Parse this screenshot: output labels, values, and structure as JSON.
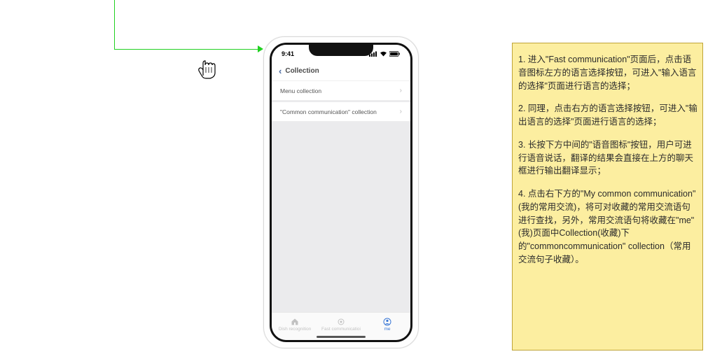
{
  "connector": {
    "arrow": true
  },
  "phone": {
    "status": {
      "time": "9:41",
      "signal": "▮▮▮▮",
      "wifi": "�礪",
      "battery": "▬"
    },
    "nav": {
      "title": "Collection"
    },
    "list": [
      {
        "label": "Menu collection"
      },
      {
        "label": "\"Common communication\" collection"
      }
    ],
    "tabs": [
      {
        "label": "Dish recognition",
        "icon": "home"
      },
      {
        "label": "Fast communicatioi",
        "icon": "target"
      },
      {
        "label": "me",
        "icon": "user",
        "active": true
      }
    ]
  },
  "note": {
    "paragraphs": [
      "1. 进入\"Fast communication\"页面后，点击语音图标左方的语言选择按钮，可进入\"输入语言的选择\"页面进行语言的选择；",
      "2. 同理，点击右方的语言选择按钮，可进入\"输出语言的选择\"页面进行语言的选择；",
      "3. 长按下方中间的\"语音图标\"按钮，用户可进行语音说话，翻译的结果会直接在上方的聊天框进行输出翻译显示；",
      "4. 点击右下方的\"My common communication\"(我的常用交流)，将可对收藏的常用交流语句进行查找，另外，常用交流语句将收藏在\"me\"(我)页面中Collection(收藏)下的\"commoncommunication\" collection（常用交流句子收藏）。"
    ]
  }
}
